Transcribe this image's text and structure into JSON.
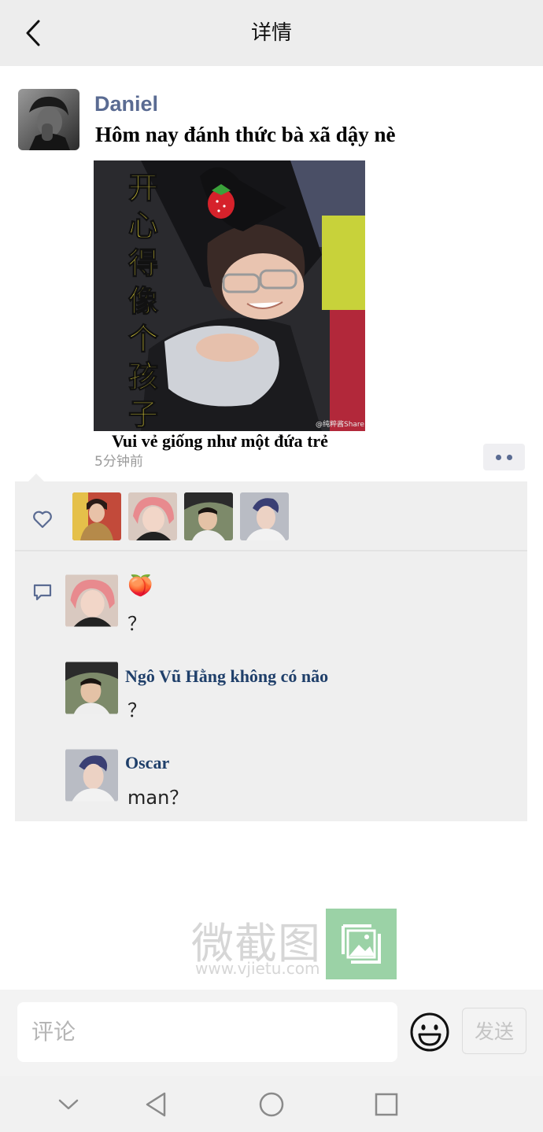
{
  "header": {
    "title": "详情",
    "back_icon": "chevron-left-icon"
  },
  "post": {
    "author": "Daniel",
    "text": "Hôm nay đánh thức bà xã dậy nè",
    "image": {
      "overlay_text": [
        "开",
        "心",
        "得",
        "像",
        "个",
        "孩",
        "子"
      ],
      "watermark": "@纯粹酱Share",
      "caption": "Vui vẻ giống như một đứa trẻ"
    },
    "time": "5分钟前",
    "more_icon": "more-dots-icon"
  },
  "likes": {
    "icon": "heart-outline-icon",
    "avatars": [
      "liker-avatar-1",
      "liker-avatar-2",
      "liker-avatar-3",
      "liker-avatar-4"
    ]
  },
  "comments": {
    "icon": "comment-bubble-icon",
    "items": [
      {
        "name": "🍑",
        "text": "？"
      },
      {
        "name": "Ngô Vũ Hằng không có não",
        "text": "？"
      },
      {
        "name": "Oscar",
        "text": "man？"
      }
    ]
  },
  "watermark": {
    "brand": "微截图",
    "url": "www.vjietu.com"
  },
  "compose": {
    "placeholder": "评论",
    "send_label": "发送",
    "emoji_icon": "smiley-icon"
  },
  "system_nav": [
    "chevron-down-icon",
    "back-triangle-icon",
    "home-circle-icon",
    "recents-square-icon"
  ],
  "colors": {
    "name_link": "#5a6b92",
    "comment_name": "#1f3f6a",
    "panel_bg": "#efefef",
    "header_bg": "#ededed"
  }
}
